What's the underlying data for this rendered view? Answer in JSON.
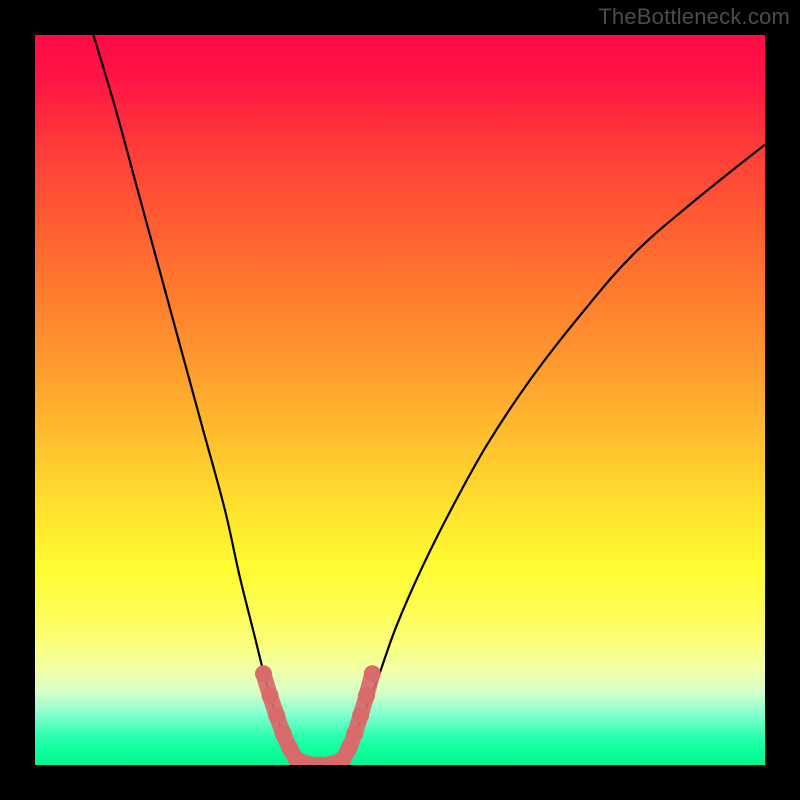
{
  "watermark": "TheBottleneck.com",
  "chart_data": {
    "type": "line",
    "title": "",
    "xlabel": "",
    "ylabel": "",
    "xlim": [
      0,
      100
    ],
    "ylim": [
      0,
      100
    ],
    "grid": false,
    "series": [
      {
        "name": "left-curve",
        "color": "#000000",
        "x": [
          8,
          11,
          14,
          17,
          20,
          23,
          26,
          28,
          30,
          31.5,
          33,
          34.5,
          36
        ],
        "values": [
          100,
          90,
          79,
          68,
          57,
          46,
          35,
          26,
          18,
          12,
          7,
          3,
          0.5
        ]
      },
      {
        "name": "right-curve",
        "color": "#000000",
        "x": [
          42,
          43.5,
          45,
          47,
          49.5,
          53,
          57,
          62,
          68,
          75,
          82,
          90,
          100
        ],
        "values": [
          0.5,
          3,
          7,
          12,
          19,
          27,
          35,
          44,
          53,
          62,
          70,
          77,
          85
        ]
      },
      {
        "name": "valley-floor",
        "color": "#000000",
        "x": [
          36,
          38,
          40,
          42
        ],
        "values": [
          0.5,
          0,
          0,
          0.5
        ]
      },
      {
        "name": "left-marker-band",
        "color": "#d96a6a",
        "style": "thick",
        "x": [
          31.3,
          32.2,
          33.1,
          34,
          34.9,
          35.8
        ],
        "values": [
          12.5,
          9.5,
          6.8,
          4.3,
          2.3,
          0.8
        ]
      },
      {
        "name": "right-marker-band",
        "color": "#d96a6a",
        "style": "thick",
        "x": [
          42.2,
          43,
          43.8,
          44.6,
          45.4,
          46.2
        ],
        "values": [
          0.8,
          2.3,
          4.3,
          6.8,
          9.5,
          12.5
        ]
      },
      {
        "name": "floor-marker-band",
        "color": "#d96a6a",
        "style": "thick",
        "x": [
          35.8,
          37.5,
          39,
          40.5,
          42.2
        ],
        "values": [
          0.8,
          0.1,
          0,
          0.1,
          0.8
        ]
      }
    ],
    "gradient_stops": [
      {
        "pos": 0,
        "color": "#ff0b48"
      },
      {
        "pos": 15,
        "color": "#ff3a3a"
      },
      {
        "pos": 35,
        "color": "#ff7a2e"
      },
      {
        "pos": 55,
        "color": "#ffbe2e"
      },
      {
        "pos": 73,
        "color": "#fffc32"
      },
      {
        "pos": 87,
        "color": "#f2ffa8"
      },
      {
        "pos": 96,
        "color": "#2effb0"
      },
      {
        "pos": 100,
        "color": "#08f690"
      }
    ]
  }
}
